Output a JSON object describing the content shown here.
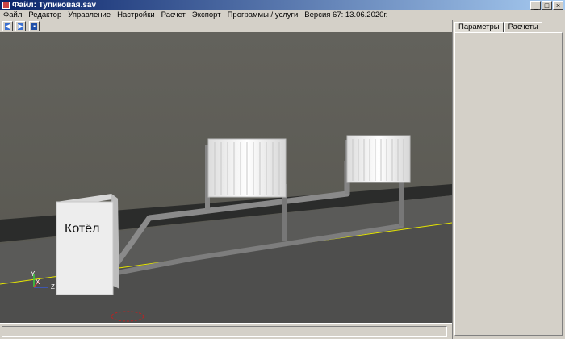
{
  "window": {
    "title": "Файл: Тупиковая.sav",
    "minimize": "_",
    "maximize": "□",
    "close": "×"
  },
  "menu": [
    "Файл",
    "Редактор",
    "Управление",
    "Настройки",
    "Расчет",
    "Экспорт",
    "Программы / услуги",
    "Версия 67: 13.06.2020г."
  ],
  "toolbar": {
    "back_icon": "arrow-left-icon",
    "forward_icon": "arrow-right-icon",
    "save_icon": "floppy-disk-icon"
  },
  "scene": {
    "boiler_label": "Котёл",
    "axis_x": "X",
    "axis_y": "Y",
    "axis_z": "Z"
  },
  "panel": {
    "tabs": [
      "Параметры",
      "Расчеты"
    ],
    "active_tab": "Параметры"
  },
  "colors": {
    "wall": "#5e5d57",
    "floor": "#4e4e4d",
    "baseboard": "#2b2c2b",
    "pipe": "#7a7a7a",
    "radiator": "#f4f4f4",
    "floor_line": "#e6e600"
  }
}
